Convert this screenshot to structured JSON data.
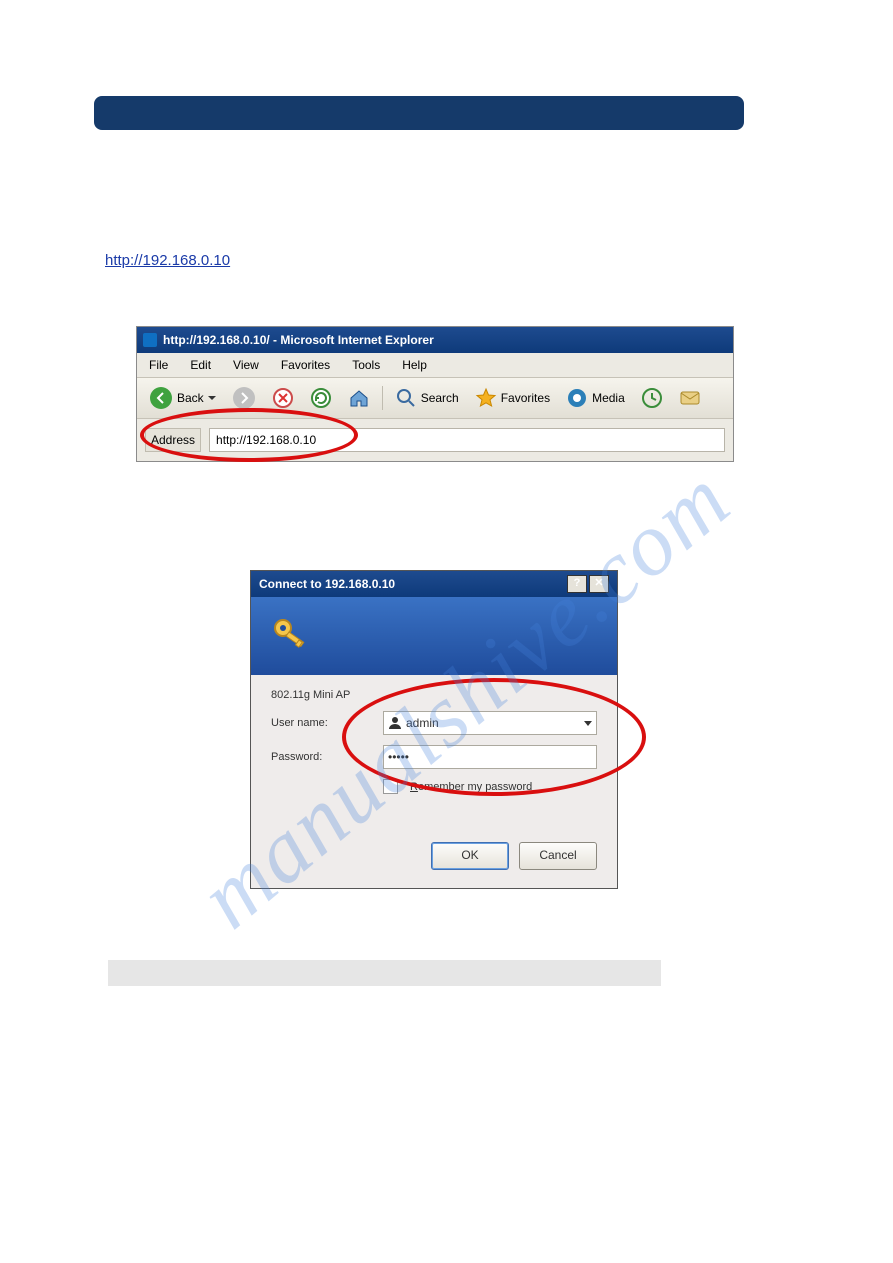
{
  "watermark": "manualshive.com",
  "body": {
    "line1": "",
    "link": "http://192.168.0.10"
  },
  "browser": {
    "title": "http://192.168.0.10/ - Microsoft Internet Explorer",
    "menu": [
      "File",
      "Edit",
      "View",
      "Favorites",
      "Tools",
      "Help"
    ],
    "toolbar": {
      "back": "Back",
      "search": "Search",
      "favorites": "Favorites",
      "media": "Media"
    },
    "address_label": "Address",
    "address_value": "http://192.168.0.10"
  },
  "dialog": {
    "title": "Connect to 192.168.0.10",
    "realm": "802.11g Mini AP",
    "username_label": "User name:",
    "username_value": "admin",
    "password_label": "Password:",
    "password_value": "•••••",
    "remember_label_pre": "R",
    "remember_label_rest": "emember my password",
    "ok": "OK",
    "cancel": "Cancel"
  }
}
